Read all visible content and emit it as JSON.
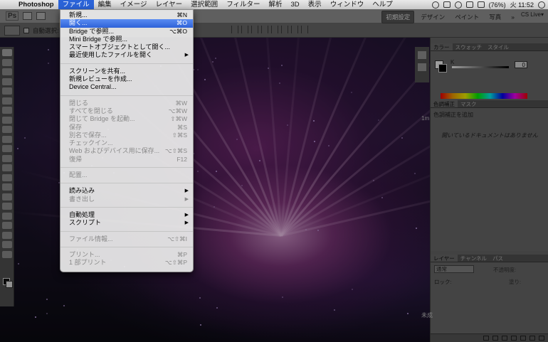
{
  "menubar": {
    "apple": "",
    "app": "Photoshop",
    "items": [
      "ファイル",
      "編集",
      "イメージ",
      "レイヤー",
      "選択範囲",
      "フィルター",
      "解析",
      "3D",
      "表示",
      "ウィンドウ",
      "ヘルプ"
    ],
    "active_index": 0,
    "battery": "(76%)",
    "clock": "火 11:52"
  },
  "appbar": {
    "logo": "Ps",
    "workspace_buttons": [
      "初期設定",
      "デザイン",
      "ペイント",
      "写真"
    ],
    "selected_workspace": 0,
    "more": "»",
    "cs_live": "CS Live▾"
  },
  "optbar": {
    "auto_select": "自動選択:"
  },
  "file_menu": {
    "items": [
      {
        "label": "新規...",
        "shortcut": "⌘N",
        "type": "item"
      },
      {
        "label": "開く...",
        "shortcut": "⌘O",
        "type": "highlighted"
      },
      {
        "label": "Bridge で参照...",
        "shortcut": "⌥⌘O",
        "type": "item"
      },
      {
        "label": "Mini Bridge で参照...",
        "shortcut": "",
        "type": "item"
      },
      {
        "label": "スマートオブジェクトとして開く...",
        "shortcut": "",
        "type": "item"
      },
      {
        "label": "最近使用したファイルを開く",
        "shortcut": "▶",
        "type": "submenu"
      },
      {
        "type": "separator"
      },
      {
        "label": "スクリーンを共有...",
        "shortcut": "",
        "type": "item"
      },
      {
        "label": "新規レビューを作成...",
        "shortcut": "",
        "type": "item"
      },
      {
        "label": "Device Central...",
        "shortcut": "",
        "type": "item"
      },
      {
        "type": "separator"
      },
      {
        "label": "閉じる",
        "shortcut": "⌘W",
        "type": "disabled"
      },
      {
        "label": "すべてを閉じる",
        "shortcut": "⌥⌘W",
        "type": "disabled"
      },
      {
        "label": "閉じて Bridge を起動...",
        "shortcut": "⇧⌘W",
        "type": "disabled"
      },
      {
        "label": "保存",
        "shortcut": "⌘S",
        "type": "disabled"
      },
      {
        "label": "別名で保存...",
        "shortcut": "⇧⌘S",
        "type": "disabled"
      },
      {
        "label": "チェックイン...",
        "shortcut": "",
        "type": "disabled"
      },
      {
        "label": "Web およびデバイス用に保存...",
        "shortcut": "⌥⇧⌘S",
        "type": "disabled"
      },
      {
        "label": "復帰",
        "shortcut": "F12",
        "type": "disabled"
      },
      {
        "type": "separator"
      },
      {
        "label": "配置...",
        "shortcut": "",
        "type": "disabled"
      },
      {
        "type": "separator"
      },
      {
        "label": "読み込み",
        "shortcut": "▶",
        "type": "submenu"
      },
      {
        "label": "書き出し",
        "shortcut": "▶",
        "type": "submenu-disabled"
      },
      {
        "type": "separator"
      },
      {
        "label": "自動処理",
        "shortcut": "▶",
        "type": "submenu"
      },
      {
        "label": "スクリプト",
        "shortcut": "▶",
        "type": "submenu"
      },
      {
        "type": "separator"
      },
      {
        "label": "ファイル情報...",
        "shortcut": "⌥⇧⌘I",
        "type": "disabled"
      },
      {
        "type": "separator"
      },
      {
        "label": "プリント...",
        "shortcut": "⌘P",
        "type": "disabled"
      },
      {
        "label": "1 部プリント",
        "shortcut": "⌥⇧⌘P",
        "type": "disabled"
      }
    ]
  },
  "panels": {
    "color": {
      "tabs": [
        "カラー",
        "スウォッチ",
        "スタイル"
      ],
      "k_label": "K",
      "k_value": "0"
    },
    "adjustments": {
      "tabs": [
        "色調補正",
        "マスク"
      ],
      "title": "色調補正を追加",
      "empty_message": "開いているドキュメントはありません"
    },
    "layers": {
      "tabs": [
        "レイヤー",
        "チャンネル",
        "パス"
      ],
      "blend_mode": "通常",
      "opacity_label": "不透明度:",
      "lock_label": "ロック:",
      "fill_label": "塗り:"
    }
  },
  "desktop_labels": {
    "one": "1m",
    "two": "未成"
  }
}
